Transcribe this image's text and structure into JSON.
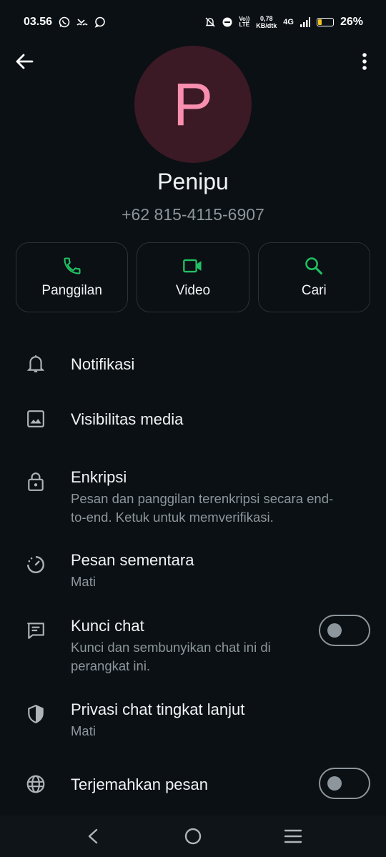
{
  "status_bar": {
    "time": "03.56",
    "network_speed_value": "0,78",
    "network_speed_unit": "KB/dtk",
    "volte_top": "Vo))",
    "volte_bottom": "LTE",
    "network_type": "4G",
    "battery": "26%",
    "battery_level": 0.26,
    "icons": [
      "whatsapp-icon",
      "missed-call-icon",
      "message-icon",
      "mute-icon",
      "dnd-icon",
      "signal-icon",
      "battery-icon"
    ]
  },
  "header": {
    "back_icon": "arrow-left-icon",
    "menu_icon": "more-vertical-icon"
  },
  "contact": {
    "avatar_letter": "P",
    "avatar_color": "#3b1a25",
    "avatar_letter_color": "#f88fae",
    "name": "Penipu",
    "phone": "+62 815-4115-6907"
  },
  "actions": [
    {
      "label": "Panggilan",
      "icon": "phone-icon"
    },
    {
      "label": "Video",
      "icon": "video-icon"
    },
    {
      "label": "Cari",
      "icon": "search-icon"
    }
  ],
  "accent_color": "#21c063",
  "settings": {
    "notifications": {
      "title": "Notifikasi",
      "icon": "bell-icon"
    },
    "media_visibility": {
      "title": "Visibilitas media",
      "icon": "image-icon"
    },
    "encryption": {
      "title": "Enkripsi",
      "subtitle": "Pesan dan panggilan terenkripsi secara end-to-end. Ketuk untuk memverifikasi.",
      "icon": "lock-icon"
    },
    "disappearing": {
      "title": "Pesan sementara",
      "subtitle": "Mati",
      "icon": "timer-icon"
    },
    "chat_lock": {
      "title": "Kunci chat",
      "subtitle": "Kunci dan sembunyikan chat ini di perangkat ini.",
      "icon": "chat-lock-icon",
      "enabled": false
    },
    "advanced_privacy": {
      "title": "Privasi chat tingkat lanjut",
      "subtitle": "Mati",
      "icon": "shield-icon"
    },
    "translate": {
      "title": "Terjemahkan pesan",
      "icon": "globe-icon",
      "enabled": false
    }
  },
  "nav_bar": {
    "icons": [
      "nav-back-icon",
      "nav-home-icon",
      "nav-recents-icon"
    ]
  }
}
